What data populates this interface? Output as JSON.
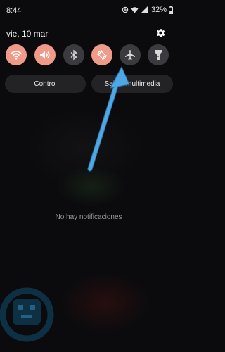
{
  "status_bar": {
    "time": "8:44",
    "battery": "32%",
    "icons": [
      "data-saver-icon",
      "wifi-icon",
      "signal-icon",
      "battery-icon"
    ]
  },
  "date": "vie, 10 mar",
  "quick_settings": {
    "tiles": [
      {
        "name": "wifi",
        "state": "on"
      },
      {
        "name": "sound",
        "state": "on"
      },
      {
        "name": "bluetooth",
        "state": "off"
      },
      {
        "name": "auto-rotate",
        "state": "on"
      },
      {
        "name": "airplane-mode",
        "state": "off"
      },
      {
        "name": "flashlight",
        "state": "off"
      }
    ],
    "buttons": {
      "control": "Control",
      "media_output": "Salida multimedia"
    }
  },
  "notifications": {
    "empty_text": "No hay notificaciones"
  },
  "colors": {
    "tile_on": "#f09a8a",
    "tile_off": "#3b3b3f",
    "arrow": "#4fa7e3"
  }
}
